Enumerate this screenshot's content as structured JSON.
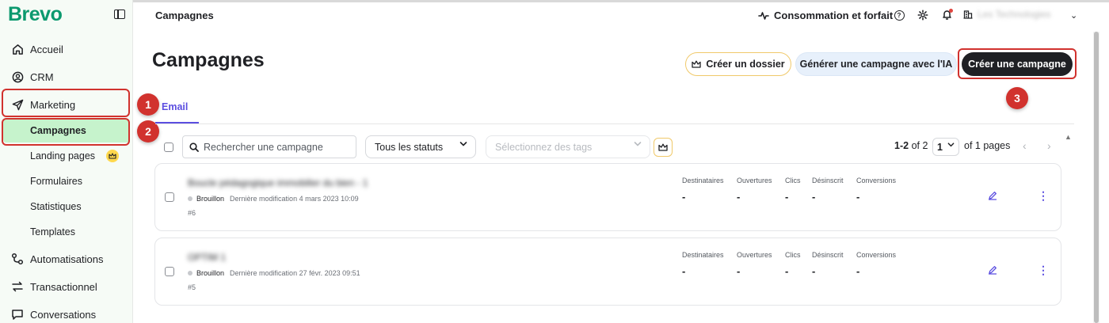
{
  "app": {
    "logo": "Brevo"
  },
  "sidebar": {
    "items": [
      {
        "label": "Accueil",
        "icon": "home-icon"
      },
      {
        "label": "CRM",
        "icon": "contacts-icon"
      },
      {
        "label": "Marketing",
        "icon": "send-icon"
      },
      {
        "label": "Automatisations",
        "icon": "automation-icon"
      },
      {
        "label": "Transactionnel",
        "icon": "arrows-icon"
      },
      {
        "label": "Conversations",
        "icon": "chat-icon"
      }
    ],
    "sub_items": [
      {
        "label": "Campagnes",
        "active": true
      },
      {
        "label": "Landing pages",
        "premium": true
      },
      {
        "label": "Formulaires"
      },
      {
        "label": "Statistiques"
      },
      {
        "label": "Templates"
      }
    ]
  },
  "topbar": {
    "title": "Campagnes",
    "consumption": "Consommation et forfait",
    "account_name": "Les Technologies"
  },
  "page": {
    "title": "Campagnes",
    "buttons": {
      "folder": "Créer un dossier",
      "ai": "Générer une campagne avec l'IA",
      "create": "Créer une campagne"
    },
    "tabs": [
      {
        "label": "Email",
        "active": true
      }
    ]
  },
  "filters": {
    "search_placeholder": "Rechercher une campagne",
    "status": "Tous les statuts",
    "tags_placeholder": "Sélectionnez des tags"
  },
  "pagination": {
    "range": "1-2",
    "of_total": "of 2",
    "current_page": "1",
    "of_pages": "of 1 pages"
  },
  "metric_labels": [
    "Destinataires",
    "Ouvertures",
    "Clics",
    "Désinscrit",
    "Conversions"
  ],
  "campaigns": [
    {
      "name": "Boucle pédagogique immobilier du bien - 1",
      "status": "Brouillon",
      "modified": "Dernière modification 4 mars 2023 10:09",
      "id": "#6",
      "metrics": [
        "-",
        "-",
        "-",
        "-",
        "-"
      ]
    },
    {
      "name": "OPTIM 1",
      "status": "Brouillon",
      "modified": "Dernière modification 27 févr. 2023 09:51",
      "id": "#5",
      "metrics": [
        "-",
        "-",
        "-",
        "-",
        "-"
      ]
    }
  ],
  "annotations": [
    "1",
    "2",
    "3"
  ],
  "colors": {
    "brand": "#0b996e",
    "accent": "#5b4ee0",
    "highlight": "#d1322e",
    "active_bg": "#c6f3cc",
    "primary_button": "#1f2024"
  }
}
